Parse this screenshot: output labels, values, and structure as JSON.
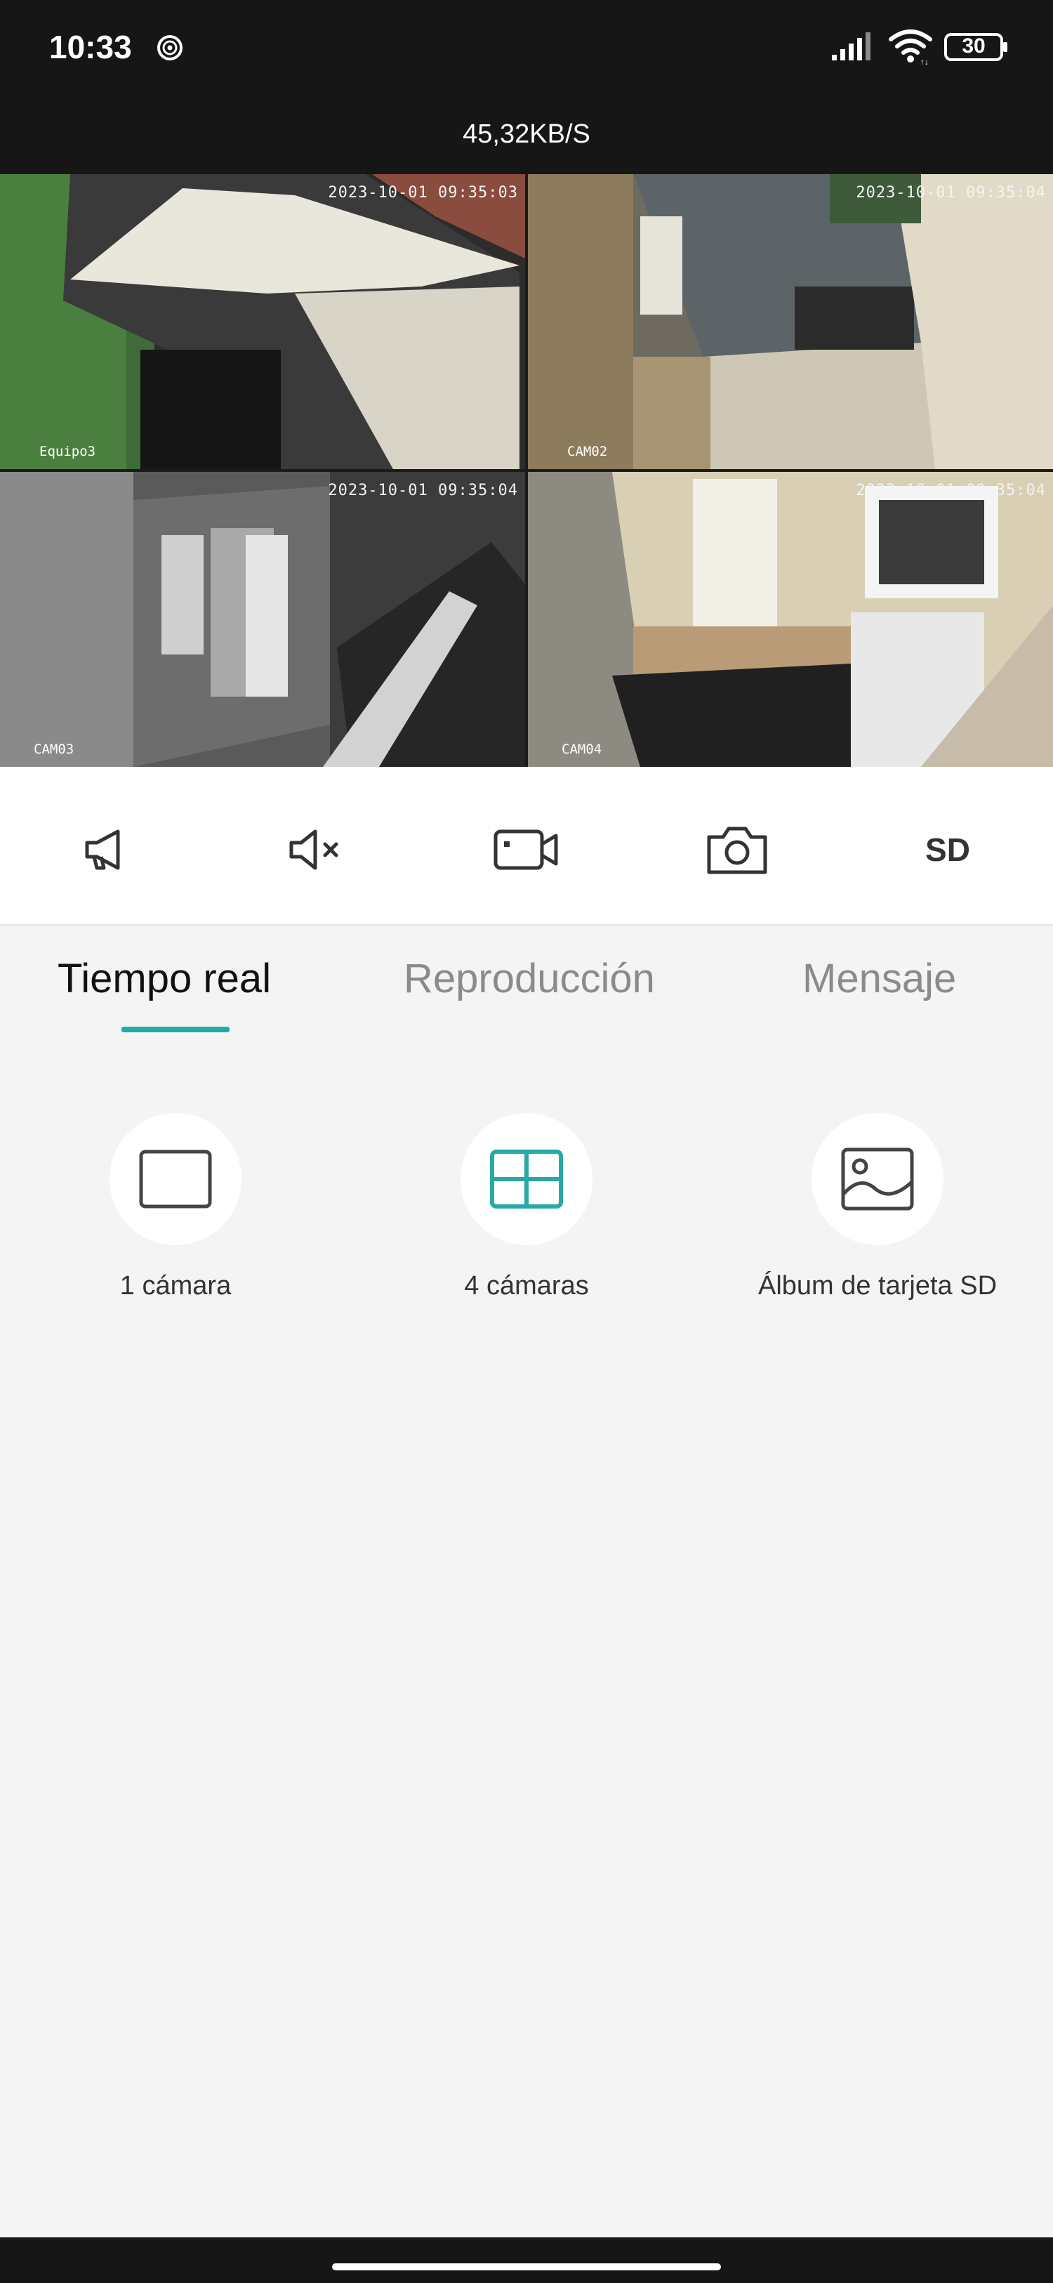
{
  "status_bar": {
    "time": "10:33",
    "battery_level": "30",
    "icons": [
      "record-icon",
      "signal-icon",
      "wifi-icon",
      "battery-icon"
    ]
  },
  "header": {
    "speed": "45,32KB/S"
  },
  "cameras": [
    {
      "timestamp": "2023-10-01 09:35:03",
      "label": "Equipo3"
    },
    {
      "timestamp": "2023-10-01 09:35:04",
      "label": "CAM02"
    },
    {
      "timestamp": "2023-10-01 09:35:04",
      "label": "CAM03"
    },
    {
      "timestamp": "2023-10-01 09:35:04",
      "label": "CAM04"
    }
  ],
  "toolbar": {
    "icons": [
      "megaphone-icon",
      "mute-icon",
      "video-record-icon",
      "camera-icon"
    ],
    "sd_label": "SD"
  },
  "tabs": [
    {
      "label": "Tiempo real",
      "active": true
    },
    {
      "label": "Reproducción",
      "active": false
    },
    {
      "label": "Mensaje",
      "active": false
    }
  ],
  "view_options": [
    {
      "label": "1 cámara",
      "icon": "single-view-icon"
    },
    {
      "label": "4 cámaras",
      "icon": "quad-view-icon"
    },
    {
      "label": "Álbum de tarjeta SD",
      "icon": "album-icon"
    }
  ],
  "colors": {
    "accent": "#27aaa6",
    "header_bg": "#161616",
    "page_bg": "#f4f4f4"
  }
}
